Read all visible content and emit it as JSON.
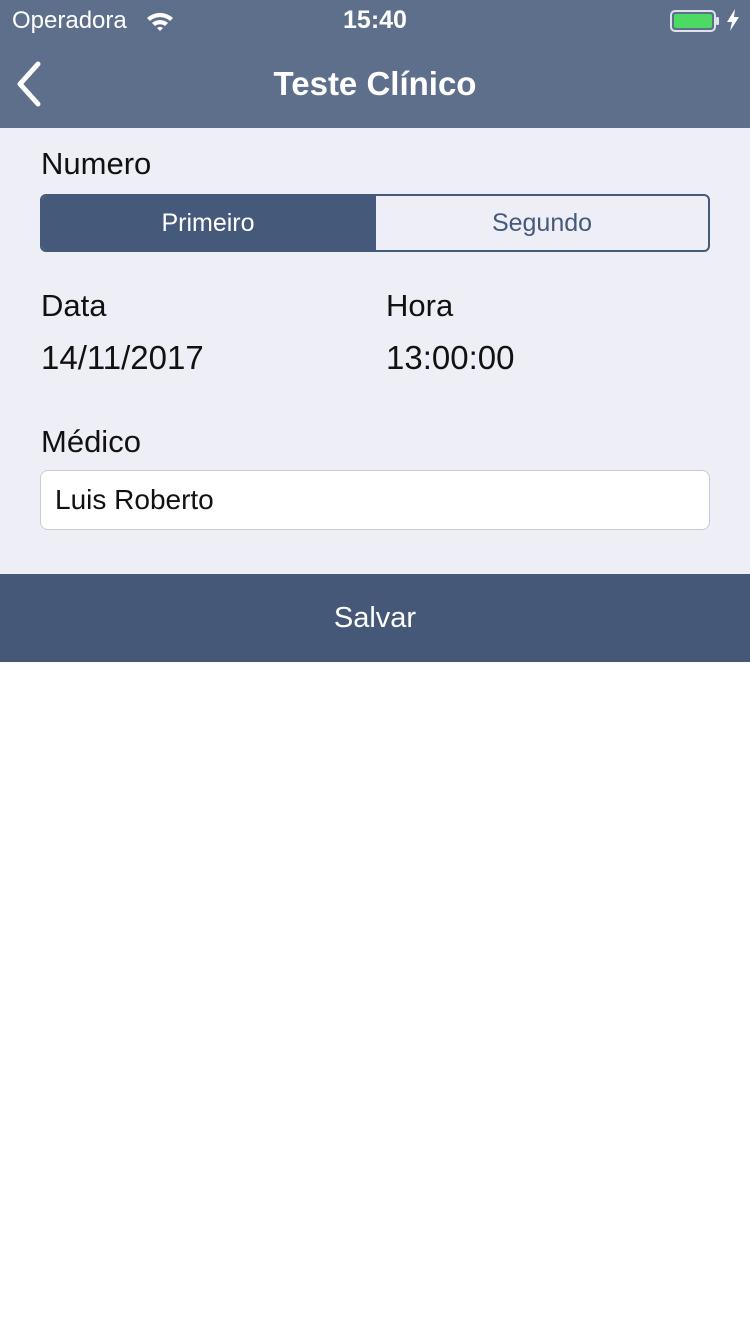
{
  "status_bar": {
    "carrier": "Operadora",
    "time": "15:40",
    "battery_color": "#4cd964"
  },
  "nav": {
    "title": "Teste Clínico",
    "background": "#5e6f8b"
  },
  "form": {
    "numero_label": "Numero",
    "segments": [
      "Primeiro",
      "Segundo"
    ],
    "selected_segment": "Primeiro",
    "data_label": "Data",
    "data_value": "14/11/2017",
    "hora_label": "Hora",
    "hora_value": "13:00:00",
    "medico_label": "Médico",
    "medico_value": "Luis Roberto"
  },
  "actions": {
    "save_label": "Salvar",
    "accent": "#455877"
  }
}
